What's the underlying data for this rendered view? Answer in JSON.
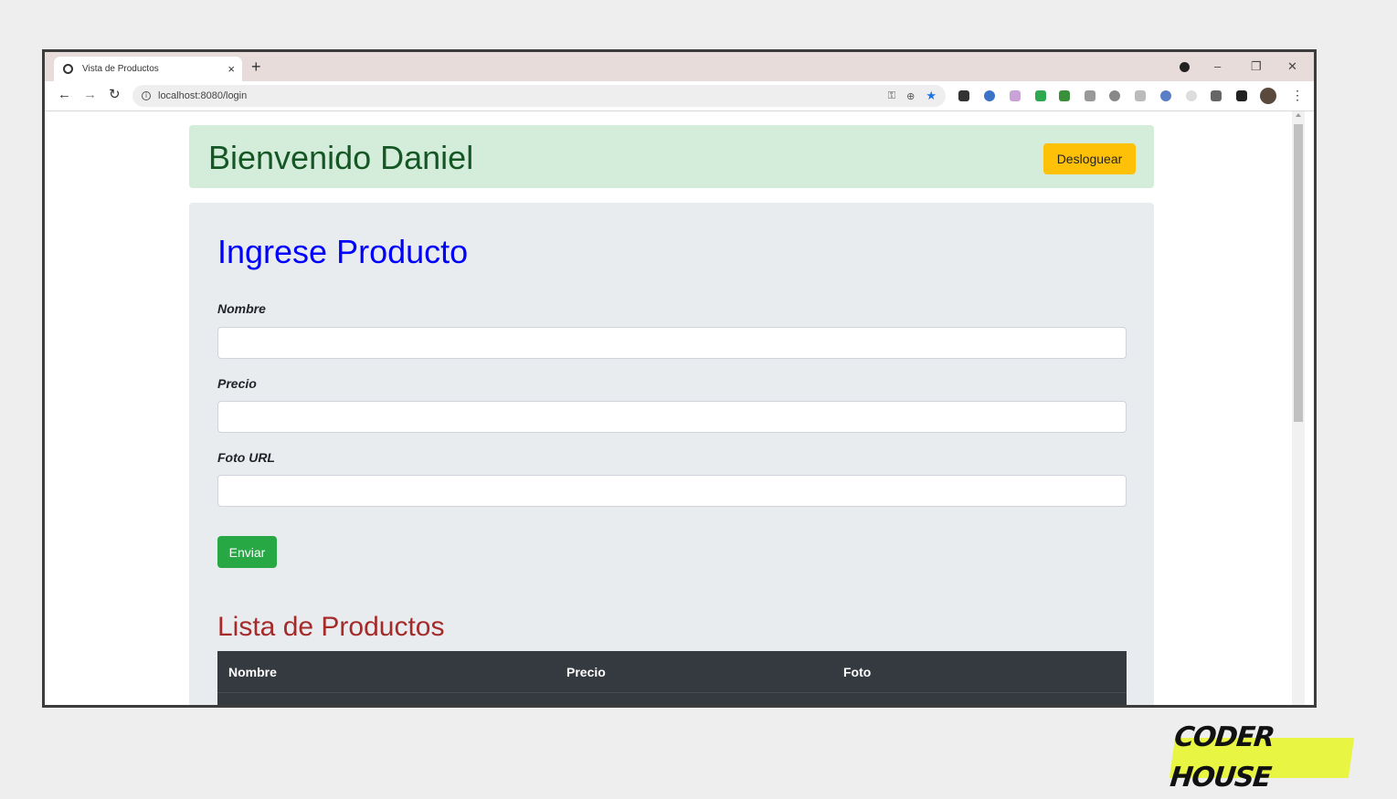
{
  "browser": {
    "tab_title": "Vista de Productos",
    "tab_close": "×",
    "new_tab": "+",
    "url": "localhost:8080/login",
    "window_controls": {
      "minimize": "–",
      "restore": "❐",
      "close": "✕"
    },
    "nav": {
      "back": "←",
      "forward": "→",
      "reload": "↻"
    }
  },
  "header": {
    "welcome": "Bienvenido Daniel",
    "logout_label": "Desloguear"
  },
  "form": {
    "title": "Ingrese Producto",
    "fields": [
      {
        "label": "Nombre",
        "value": ""
      },
      {
        "label": "Precio",
        "value": ""
      },
      {
        "label": "Foto URL",
        "value": ""
      }
    ],
    "submit_label": "Enviar"
  },
  "product_list": {
    "title": "Lista de Productos",
    "columns": [
      "Nombre",
      "Precio",
      "Foto"
    ]
  },
  "branding": {
    "logo_text": "CODER HOUSE"
  },
  "colors": {
    "alert_bg": "#d4edda",
    "alert_text": "#155724",
    "logout_btn": "#ffc107",
    "submit_btn": "#28a745",
    "form_title": "#0000ff",
    "list_title": "#a52a2a",
    "table_dark": "#343a40",
    "logo_bg": "#e8f543"
  }
}
